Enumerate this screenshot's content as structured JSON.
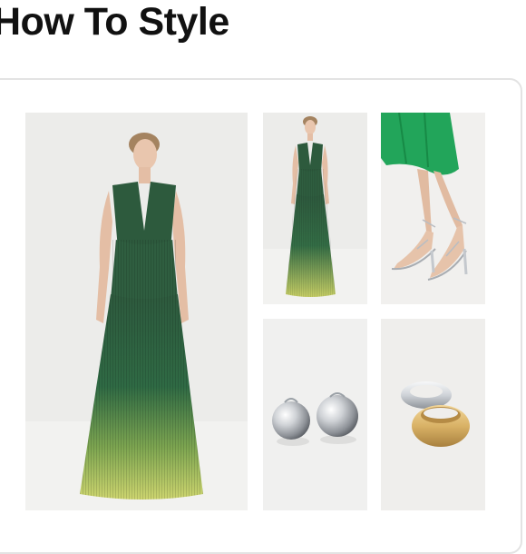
{
  "section": {
    "title": "How To Style"
  },
  "products": [
    {
      "icon": "green-ombre-pleated-maxi-dress"
    },
    {
      "icon": "green-ombre-pleated-maxi-dress"
    },
    {
      "icon": "clear-strappy-heel-sandals"
    },
    {
      "icon": "silver-dome-earrings"
    },
    {
      "icon": "silver-and-gold-dome-rings"
    }
  ],
  "colors": {
    "dress_top": "#2f5c3f",
    "dress_bottom": "#c9d36c",
    "satin_green": "#22a55a",
    "silver": "#d5d8dc",
    "gold": "#d9b266",
    "tile_bg": "#ececea"
  }
}
